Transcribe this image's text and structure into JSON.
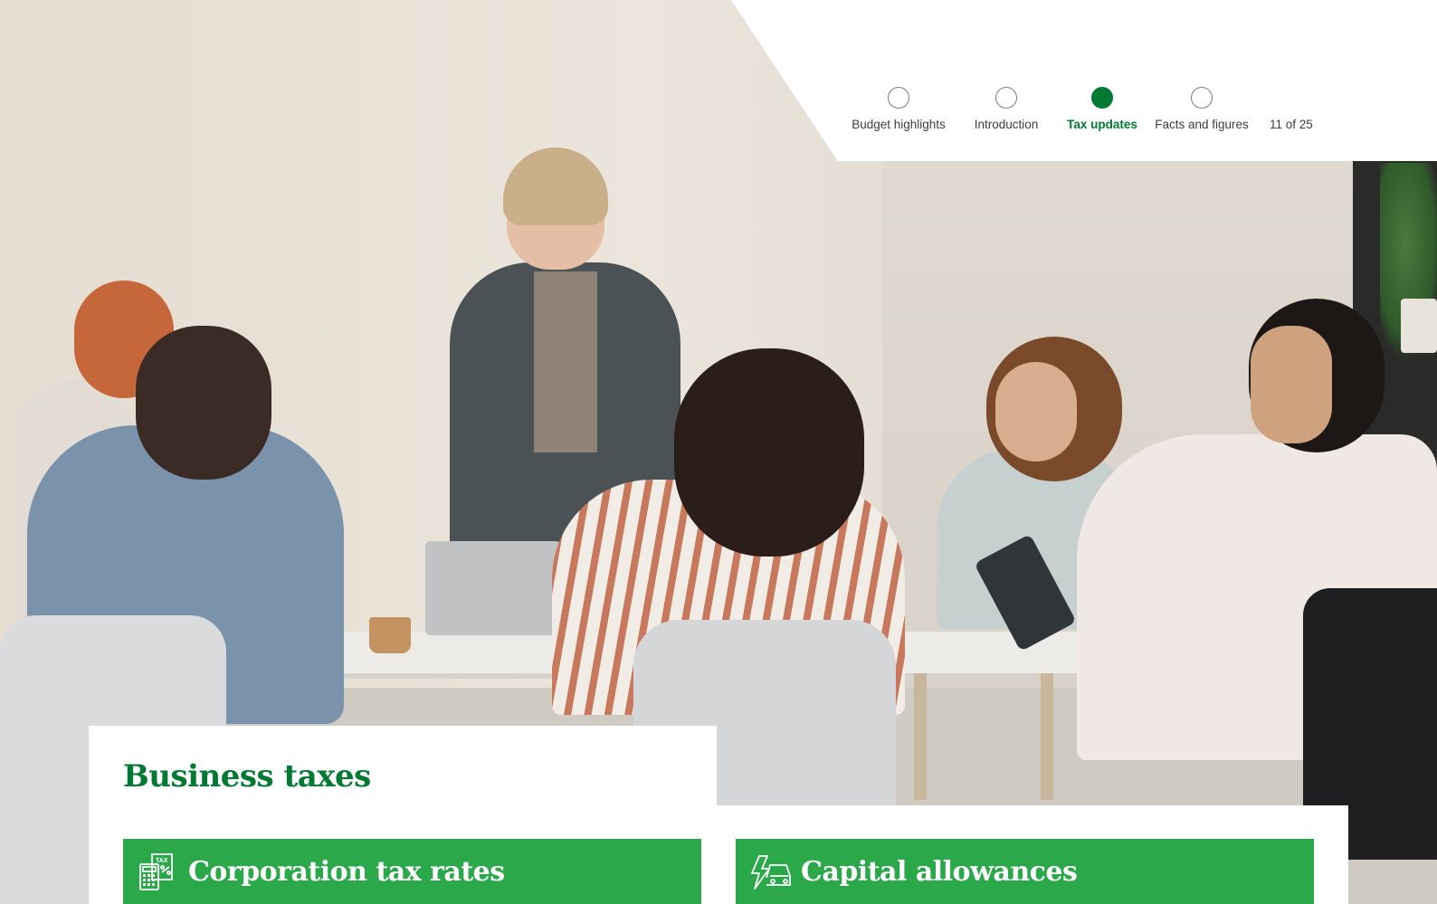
{
  "nav": {
    "steps": [
      {
        "label": "Budget highlights",
        "active": false
      },
      {
        "label": "Introduction",
        "active": false
      },
      {
        "label": "Tax updates",
        "active": true
      },
      {
        "label": "Facts and figures",
        "active": false
      }
    ],
    "page_count": "11 of 25"
  },
  "page": {
    "title": "Business taxes"
  },
  "sections": [
    {
      "label": "Corporation tax rates",
      "icon": "tax-calculator-icon"
    },
    {
      "label": "Capital allowances",
      "icon": "electric-car-icon"
    }
  ],
  "colors": {
    "brand_green": "#007a33",
    "tile_green": "#2aa84a"
  }
}
